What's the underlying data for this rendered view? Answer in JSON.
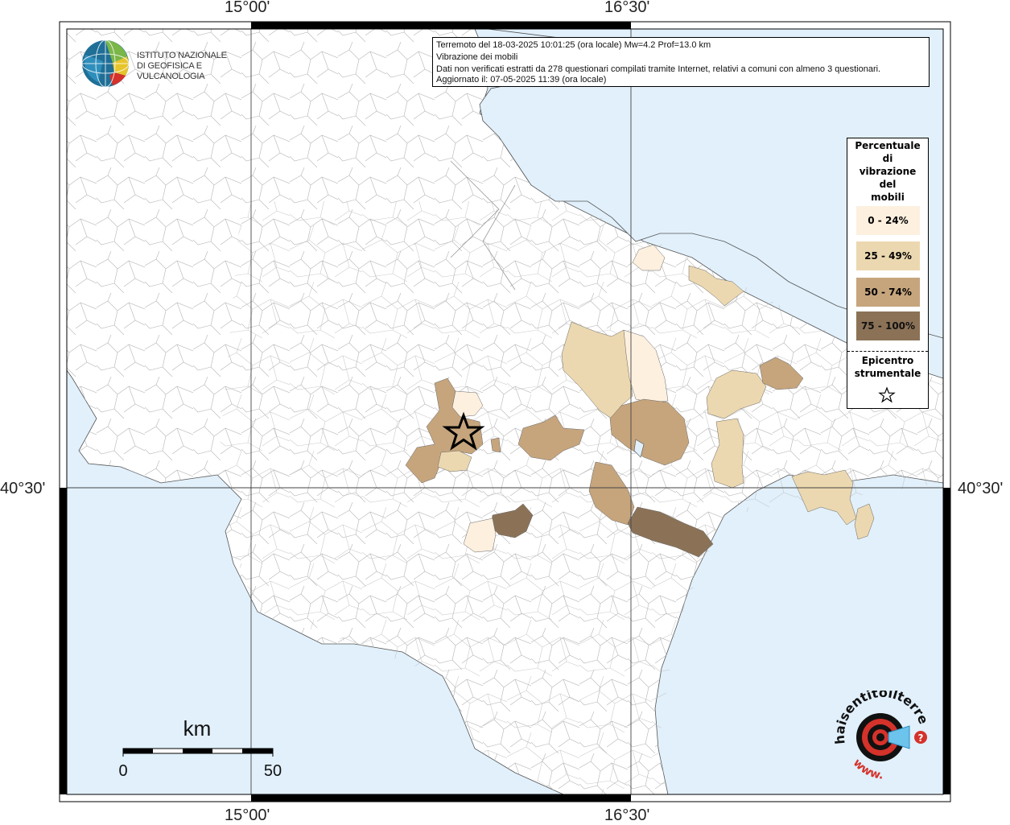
{
  "map": {
    "coords": {
      "top_lon_1": "15°00'",
      "top_lon_2": "16°30'",
      "bottom_lon_1": "15°00'",
      "bottom_lon_2": "16°30'",
      "left_lat": "40°30'",
      "right_lat": "40°30'"
    },
    "info": {
      "line1": "Terremoto del 18-03-2025 10:01:25 (ora locale) Mw=4.2 Prof=13.0 km",
      "line2": "Vibrazione dei mobili",
      "line3": "Dati non verificati estratti da 278 questionari compilati tramite Internet, relativi a comuni con almeno 3 questionari.",
      "line4": "Aggiornato il: 07-05-2025 11:39 (ora locale)"
    },
    "legend": {
      "title_lines": [
        "Percentuale",
        "di",
        "vibrazione",
        "del",
        "mobili"
      ],
      "items": [
        {
          "label": "0 - 24%",
          "color": "#fdf0df"
        },
        {
          "label": "25 - 49%",
          "color": "#ecd8b0"
        },
        {
          "label": "50 - 74%",
          "color": "#c6a57d"
        },
        {
          "label": "75 - 100%",
          "color": "#8b7257"
        }
      ],
      "epicenter_lines": [
        "Epicentro",
        "strumentale"
      ]
    },
    "ingv": {
      "line1": "ISTITUTO NAZIONALE",
      "line2": "DI GEOFISICA E VULCANOLOGIA"
    },
    "scale": {
      "unit": "km",
      "tick_min": "0",
      "tick_max": "50"
    },
    "hst": {
      "text_top": "haisentitoilterremoto.it",
      "text_bottom": "www."
    },
    "colors": {
      "sea": "#e1f0fb",
      "land": "#ffffff",
      "border": "#9a9a9a"
    }
  }
}
